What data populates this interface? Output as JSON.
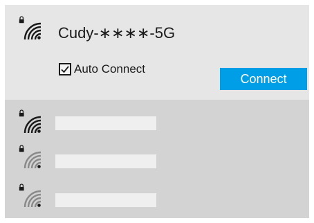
{
  "selected_network": {
    "ssid": "Cudy-∗∗∗∗-5G",
    "auto_connect_label": "Auto Connect",
    "auto_connect_checked": true,
    "connect_label": "Connect",
    "icon": "wifi-secured-icon"
  },
  "other_networks": [
    {
      "name": "",
      "icon": "wifi-secured-icon",
      "signal": "full"
    },
    {
      "name": "",
      "icon": "wifi-secured-icon",
      "signal": "weak"
    },
    {
      "name": "",
      "icon": "wifi-secured-icon",
      "signal": "weak"
    }
  ],
  "colors": {
    "accent": "#009ee6",
    "selected_bg": "#e6e6e6",
    "list_bg": "#d3d3d3",
    "placeholder": "#efefef"
  }
}
